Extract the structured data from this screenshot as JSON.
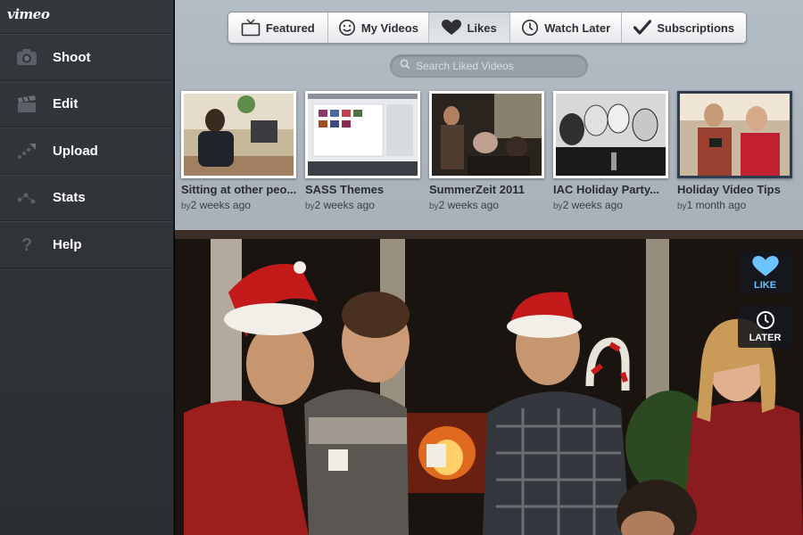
{
  "app": {
    "logo": "vimeo"
  },
  "sidebar": {
    "items": [
      {
        "label": "Shoot",
        "icon": "camera-icon"
      },
      {
        "label": "Edit",
        "icon": "clapperboard-icon"
      },
      {
        "label": "Upload",
        "icon": "upload-arrow-icon"
      },
      {
        "label": "Stats",
        "icon": "stats-dots-icon"
      },
      {
        "label": "Help",
        "icon": "question-icon"
      }
    ]
  },
  "tabs": [
    {
      "label": "Featured",
      "icon": "tv-icon",
      "active": false
    },
    {
      "label": "My Videos",
      "icon": "smiley-icon",
      "active": false
    },
    {
      "label": "Likes",
      "icon": "heart-icon",
      "active": true
    },
    {
      "label": "Watch Later",
      "icon": "clock-icon",
      "active": false
    },
    {
      "label": "Subscriptions",
      "icon": "checkmark-icon",
      "active": false
    }
  ],
  "search": {
    "placeholder": "Search Liked Videos",
    "value": ""
  },
  "videos": [
    {
      "title": "Sitting at other peo...",
      "by": "by",
      "age": "2 weeks ago",
      "selected": false
    },
    {
      "title": "SASS Themes",
      "by": "by",
      "age": "2 weeks ago",
      "selected": false
    },
    {
      "title": "SummerZeit 2011",
      "by": "by",
      "age": "2 weeks ago",
      "selected": false
    },
    {
      "title": "IAC Holiday Party...",
      "by": "by",
      "age": "2 weeks ago",
      "selected": false
    },
    {
      "title": "Holiday Video Tips",
      "by": "by",
      "age": "1 month ago",
      "selected": true
    }
  ],
  "player": {
    "like_label": "LIKE",
    "later_label": "LATER"
  },
  "colors": {
    "sidebar_bg": "#2f3236",
    "header_bg": "#b0b8c2",
    "like_accent": "#6cc3ff",
    "selected_thumb_border": "#2e3d52"
  }
}
